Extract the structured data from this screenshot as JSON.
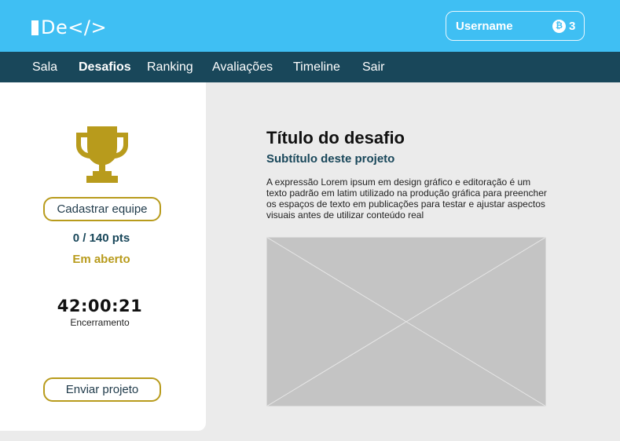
{
  "header": {
    "logo_text": "De</>",
    "username": "Username",
    "coin_symbol": "₿",
    "coin_count": "3",
    "colors": {
      "topbar": "#3fbff3",
      "navbar": "#19475a",
      "accent_gold": "#b89b1c"
    }
  },
  "nav": {
    "items": [
      {
        "label": "Sala"
      },
      {
        "label": "Desafios",
        "active": true
      },
      {
        "label": "Ranking"
      },
      {
        "label": "Avaliações"
      },
      {
        "label": "Timeline"
      },
      {
        "label": "Sair"
      }
    ]
  },
  "sidebar": {
    "trophy_icon": "trophy-icon",
    "register_team_label": "Cadastrar equipe",
    "points": "0 / 140 pts",
    "status": "Em aberto",
    "timer": "42:00:21",
    "timer_label": "Encerramento",
    "submit_label": "Enviar projeto"
  },
  "main": {
    "title": "Título do desafio",
    "subtitle": "Subtítulo deste projeto",
    "description": "A expressão Lorem ipsum em design gráfico e editoração é um texto padrão em latim utilizado na produção gráfica para preencher os espaços de texto em publicações para testar e ajustar aspectos visuais antes de utilizar conteúdo real",
    "image_placeholder_icon": "image-placeholder-icon"
  }
}
